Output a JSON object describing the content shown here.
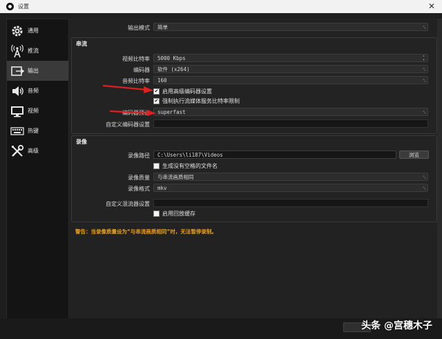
{
  "window": {
    "title": "设置",
    "close_glyph": "✕"
  },
  "sidebar": {
    "items": [
      {
        "label": "通用",
        "icon": "gear-icon"
      },
      {
        "label": "推流",
        "icon": "broadcast-icon"
      },
      {
        "label": "输出",
        "icon": "output-icon",
        "active": true
      },
      {
        "label": "音频",
        "icon": "speaker-icon"
      },
      {
        "label": "视频",
        "icon": "monitor-icon"
      },
      {
        "label": "热键",
        "icon": "keyboard-icon"
      },
      {
        "label": "高级",
        "icon": "tools-icon"
      }
    ]
  },
  "output_mode": {
    "label": "输出模式",
    "value": "简单"
  },
  "streaming": {
    "title": "串流",
    "video_bitrate": {
      "label": "视频比特率",
      "value": "5000 Kbps"
    },
    "encoder": {
      "label": "编码器",
      "value": "软件 (x264)"
    },
    "audio_bitrate": {
      "label": "音频比特率",
      "value": "160"
    },
    "advanced_encoder_check": {
      "label": "启用高级编码器设置",
      "checked": true
    },
    "enforce_bitrate_check": {
      "label": "强制执行流媒体服务比特率限制",
      "checked": true
    },
    "encoder_preset": {
      "label": "编码器预设",
      "value": "superfast"
    },
    "custom_encoder_settings": {
      "label": "自定义编码器设置",
      "value": ""
    }
  },
  "recording": {
    "title": "录像",
    "path": {
      "label": "录像路径",
      "value": "C:\\Users\\li187\\Videos"
    },
    "browse_label": "浏览",
    "no_space_check": {
      "label": "生成没有空格的文件名",
      "checked": false
    },
    "quality": {
      "label": "录像质量",
      "value": "与串流画质相同"
    },
    "format": {
      "label": "录像格式",
      "value": "mkv"
    },
    "custom_muxer": {
      "label": "自定义混流器设置",
      "value": ""
    },
    "replay_buffer_check": {
      "label": "启用回放缓存",
      "checked": false
    }
  },
  "warning": "警告：当录像质量设为“与串流画质相同”时，无法暂停录制。",
  "watermark": "头条 @宫穗木子",
  "colors": {
    "warning": "#e8a020",
    "arrow": "#e02020",
    "active_item": "#3a3a3a"
  }
}
